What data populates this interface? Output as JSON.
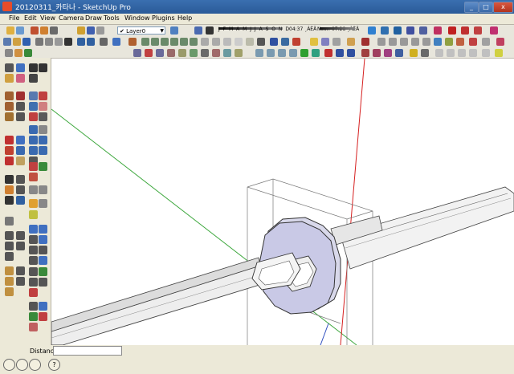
{
  "window": {
    "title": "20120311_카타나 - SketchUp Pro"
  },
  "menu": {
    "items": [
      "File",
      "Edit",
      "View",
      "Camera",
      "Draw",
      "Tools",
      "Window",
      "Plugins",
      "Help"
    ]
  },
  "layer": {
    "current": "Layer0"
  },
  "shadow": {
    "months": "J F M A M J J A S O N D",
    "time_start": "04:37 ¸ÀÈÄ",
    "time_noon": "Noon",
    "time_end": "07:28 ¸ÀÈÄ"
  },
  "status": {
    "measurements_label": "Distance",
    "measurements_value": "",
    "help_icon": "?"
  },
  "colors": {
    "titlebar": "#2a5a98",
    "axis_red": "#d62020",
    "axis_green": "#3fa83f",
    "axis_blue": "#3050c0",
    "guard_fill": "#c9c9e6"
  }
}
